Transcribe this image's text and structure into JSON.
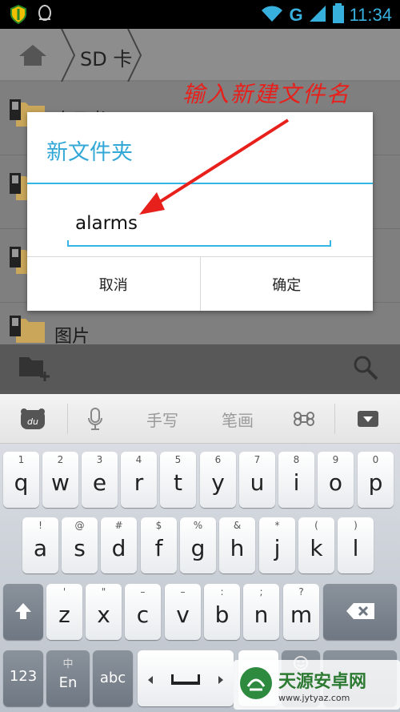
{
  "status": {
    "time": "11:34",
    "network": "G"
  },
  "breadcrumb": {
    "current": "SD 卡"
  },
  "file_list": {
    "items": [
      {
        "label": "电子书"
      },
      {
        "label": ""
      },
      {
        "label": ""
      },
      {
        "label": "图片"
      }
    ]
  },
  "dialog": {
    "title": "新文件夹",
    "input_value": "alarms",
    "cancel_label": "取消",
    "ok_label": "确定"
  },
  "annotation": {
    "text": "输入新建文件名"
  },
  "ime_bar": {
    "handwriting_label": "手写",
    "stroke_label": "笔画"
  },
  "keyboard": {
    "row1": [
      {
        "hint": "1",
        "key": "q"
      },
      {
        "hint": "2",
        "key": "w"
      },
      {
        "hint": "3",
        "key": "e"
      },
      {
        "hint": "4",
        "key": "r"
      },
      {
        "hint": "5",
        "key": "t"
      },
      {
        "hint": "6",
        "key": "y"
      },
      {
        "hint": "7",
        "key": "u"
      },
      {
        "hint": "8",
        "key": "i"
      },
      {
        "hint": "9",
        "key": "o"
      },
      {
        "hint": "0",
        "key": "p"
      }
    ],
    "row2": [
      {
        "hint": "!",
        "key": "a"
      },
      {
        "hint": "@",
        "key": "s"
      },
      {
        "hint": "#",
        "key": "d"
      },
      {
        "hint": "$",
        "key": "f"
      },
      {
        "hint": "%",
        "key": "g"
      },
      {
        "hint": "&",
        "key": "h"
      },
      {
        "hint": "*",
        "key": "j"
      },
      {
        "hint": "(",
        "key": "k"
      },
      {
        "hint": ")",
        "key": "l"
      }
    ],
    "row3": [
      {
        "hint": "'",
        "key": "z"
      },
      {
        "hint": "\"",
        "key": "x"
      },
      {
        "hint": "–",
        "key": "c"
      },
      {
        "hint": "–",
        "key": "v"
      },
      {
        "hint": ":",
        "key": "b"
      },
      {
        "hint": ";",
        "key": "n"
      },
      {
        "hint": "?",
        "key": "m"
      }
    ],
    "numbers_label": "123",
    "lang_top": "中",
    "lang_bottom": "En",
    "abc_label": "abc",
    "comma_label": ","
  },
  "watermark": {
    "name": "天源安卓网",
    "url": "www.jytyaz.com"
  },
  "colors": {
    "accent": "#33b5e5",
    "annotation": "#e8201c"
  }
}
